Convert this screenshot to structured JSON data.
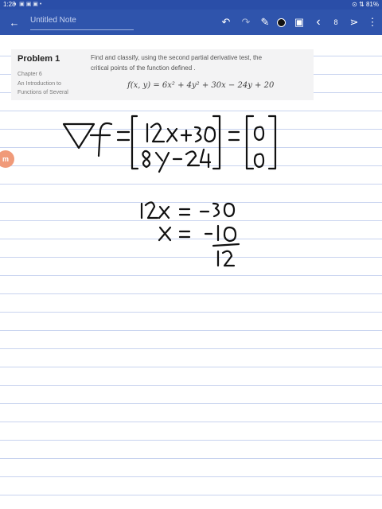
{
  "status_bar": {
    "time": "1:28",
    "icons": "◐ ▣ ▣ ▣ •",
    "right": "⊙ ⇅ 81%"
  },
  "toolbar": {
    "back_icon": "←",
    "title": "Untitled Note",
    "undo_icon": "↶",
    "redo_icon": "↷",
    "pen_icon": "✎",
    "image_icon": "▣",
    "prev_icon": "‹",
    "page": "8",
    "next_icon": "⋗",
    "more_icon": "⋮"
  },
  "problem": {
    "title": "Problem 1",
    "chapter": "Chapter 6",
    "subtitle_line1": "An Introduction to",
    "subtitle_line2": "Functions of Several",
    "text_line1": "Find and classify, using the second partial derivative test, the",
    "text_line2": "critical points of the function defined .",
    "formula": "f(x, y) = 6x² + 4y² + 30x − 24y + 20"
  },
  "side_badge": {
    "text": "m"
  },
  "colors": {
    "toolbar": "#2f54ac",
    "status_bar": "#2a4ea8",
    "ruled_line": "#c8d3ef",
    "card": "#f3f3f4",
    "badge": "#f09a79"
  }
}
